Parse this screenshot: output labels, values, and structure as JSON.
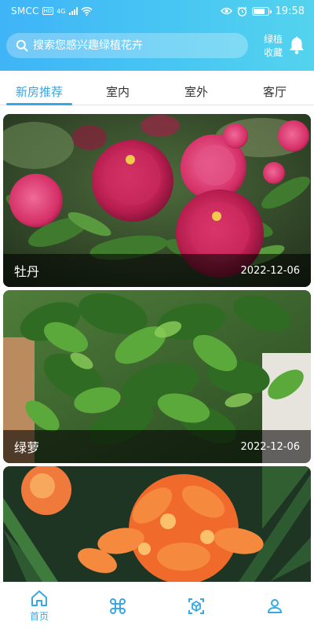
{
  "status_bar": {
    "carrier": "SMCC",
    "hd_badge": "HD",
    "network": "4G",
    "time": "19:58",
    "battery_level": 0.8,
    "icons": [
      "eye-icon",
      "alarm-icon",
      "wifi-icon",
      "signal-icon",
      "battery-icon"
    ]
  },
  "header": {
    "search_placeholder": "搜索您感兴趣绿植花卉",
    "favorites_label": "绿植收藏",
    "colors": {
      "gradient_start": "#3fb4f7",
      "gradient_end": "#54d3ee"
    }
  },
  "tabs": [
    {
      "label": "新房推荐",
      "active": true
    },
    {
      "label": "室内",
      "active": false
    },
    {
      "label": "室外",
      "active": false
    },
    {
      "label": "客厅",
      "active": false
    }
  ],
  "cards": [
    {
      "name": "牡丹",
      "date": "2022-12-06"
    },
    {
      "name": "绿萝",
      "date": "2022-12-06"
    },
    {
      "name": "",
      "date": ""
    }
  ],
  "bottom_nav": [
    {
      "label": "首页",
      "icon": "home-icon",
      "active": true
    },
    {
      "label": "",
      "icon": "command-icon",
      "active": false
    },
    {
      "label": "",
      "icon": "cube-icon",
      "active": false
    },
    {
      "label": "",
      "icon": "user-icon",
      "active": false
    }
  ],
  "colors": {
    "accent": "#36a8e6"
  }
}
